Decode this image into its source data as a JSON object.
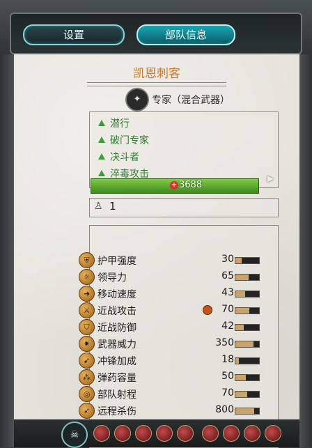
{
  "tabs": [
    {
      "label": "设置",
      "active": false
    },
    {
      "label": "部队信息",
      "active": true
    }
  ],
  "unit": {
    "name": "凯恩刺客",
    "class_label": "专家（混合武器）",
    "class_icon": "specialist-icon"
  },
  "abilities": [
    "潜行",
    "破门专家",
    "决斗者",
    "淬毒攻击"
  ],
  "unit_count": "1",
  "health": "3688",
  "stats": [
    {
      "label": "护甲强度",
      "value": "30",
      "fill": 0.25,
      "icon": "armor-icon"
    },
    {
      "label": "领导力",
      "value": "65",
      "fill": 0.55,
      "icon": "leadership-icon"
    },
    {
      "label": "移动速度",
      "value": "43",
      "fill": 0.4,
      "icon": "speed-icon"
    },
    {
      "label": "近战攻击",
      "value": "70",
      "fill": 0.6,
      "icon": "melee-attack-icon",
      "boosted": true
    },
    {
      "label": "近战防御",
      "value": "42",
      "fill": 0.35,
      "icon": "melee-defense-icon"
    },
    {
      "label": "武器威力",
      "value": "350",
      "fill": 0.75,
      "icon": "weapon-strength-icon"
    },
    {
      "label": "冲锋加成",
      "value": "18",
      "fill": 0.15,
      "icon": "charge-bonus-icon"
    },
    {
      "label": "弹药容量",
      "value": "50",
      "fill": 0.45,
      "icon": "ammunition-icon"
    },
    {
      "label": "部队射程",
      "value": "70",
      "fill": 0.5,
      "icon": "range-icon"
    },
    {
      "label": "远程杀伤",
      "value": "800",
      "fill": 0.8,
      "icon": "missile-damage-icon"
    }
  ],
  "colors": {
    "unit_name": "#d97b25",
    "ability_text": "#2f7d31",
    "tab_active": "#1aa7b5",
    "health_bar": "#5aa82f",
    "parchment": "#e6e3dc"
  }
}
